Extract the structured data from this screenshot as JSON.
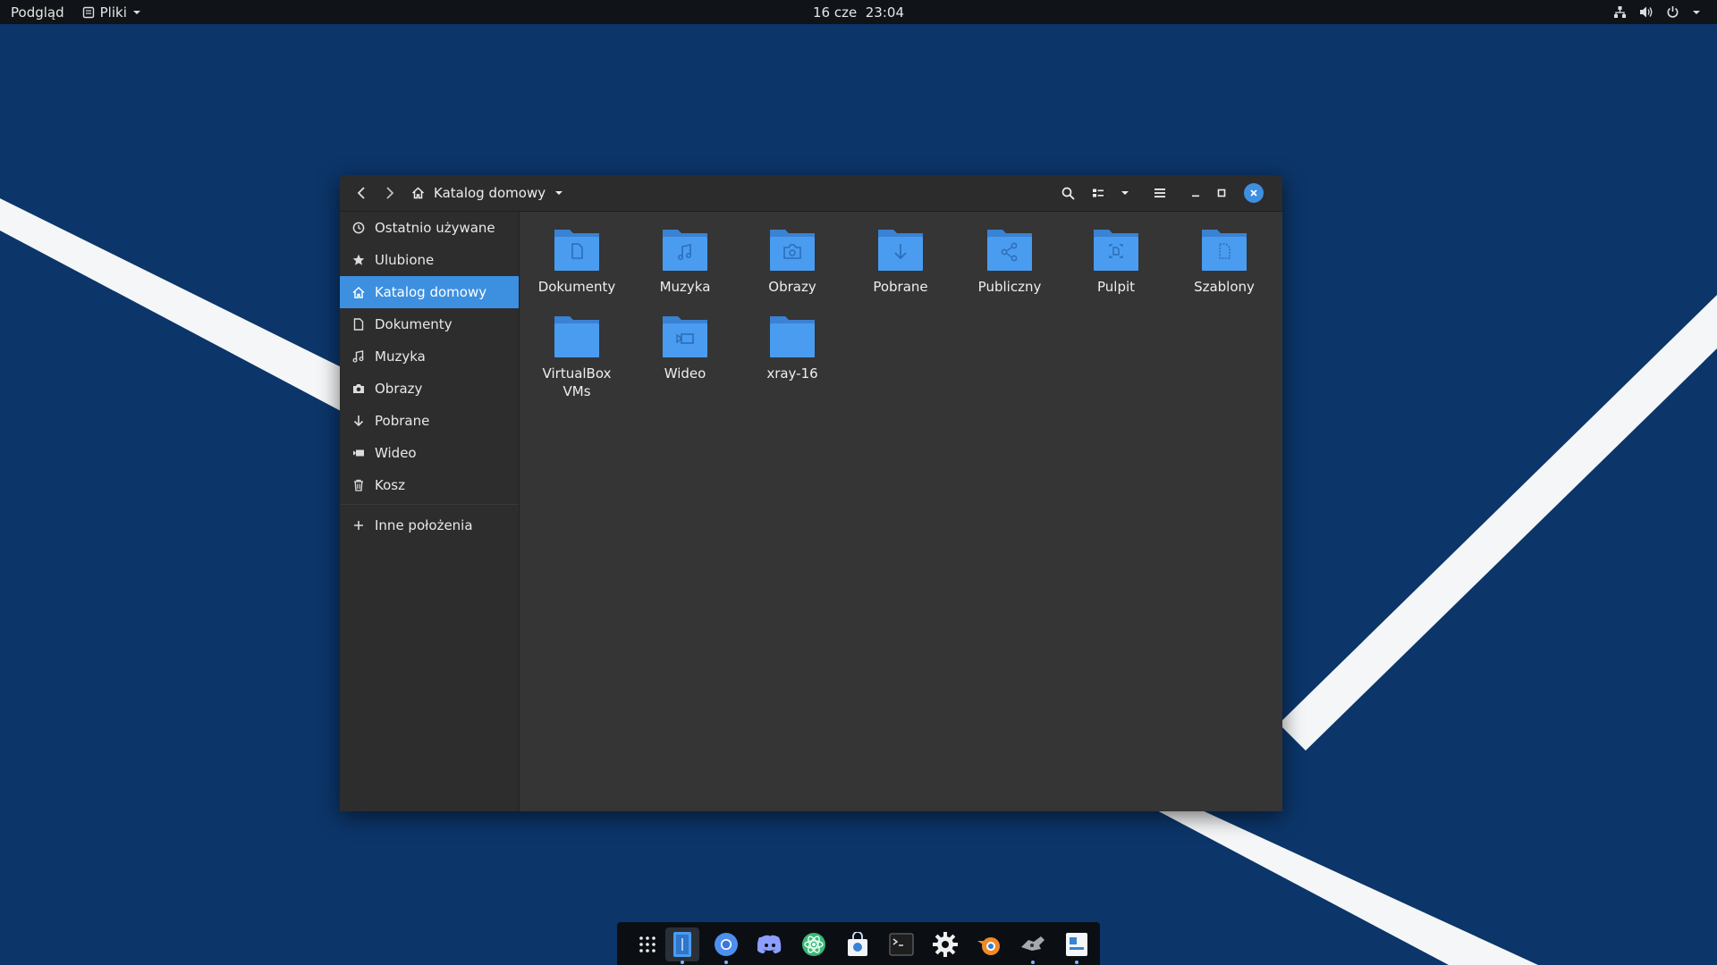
{
  "topbar": {
    "activities_label": "Podgląd",
    "app_menu_label": "Pliki",
    "date": "16 cze",
    "time": "23:04",
    "icons": [
      "network-icon",
      "volume-icon",
      "power-icon",
      "chevron-down-icon"
    ]
  },
  "window": {
    "breadcrumb_label": "Katalog domowy",
    "header_icons": [
      "back-icon",
      "forward-icon",
      "home-icon",
      "chevron-down-icon",
      "search-icon",
      "view-list-icon",
      "chevron-down-icon",
      "menu-icon",
      "minimize-icon",
      "maximize-icon",
      "close-icon"
    ]
  },
  "sidebar": {
    "items": [
      {
        "label": "Ostatnio używane",
        "icon": "clock-icon"
      },
      {
        "label": "Ulubione",
        "icon": "star-icon"
      },
      {
        "label": "Katalog domowy",
        "icon": "home-icon",
        "active": true
      },
      {
        "label": "Dokumenty",
        "icon": "document-icon"
      },
      {
        "label": "Muzyka",
        "icon": "music-icon"
      },
      {
        "label": "Obrazy",
        "icon": "camera-icon"
      },
      {
        "label": "Pobrane",
        "icon": "download-icon"
      },
      {
        "label": "Wideo",
        "icon": "video-icon"
      },
      {
        "label": "Kosz",
        "icon": "trash-icon"
      }
    ],
    "other_locations": {
      "label": "Inne położenia",
      "icon": "plus-icon"
    }
  },
  "files": [
    {
      "label": "Dokumenty",
      "emblem": "document"
    },
    {
      "label": "Muzyka",
      "emblem": "music"
    },
    {
      "label": "Obrazy",
      "emblem": "camera"
    },
    {
      "label": "Pobrane",
      "emblem": "download"
    },
    {
      "label": "Publiczny",
      "emblem": "share"
    },
    {
      "label": "Pulpit",
      "emblem": "desktop"
    },
    {
      "label": "Szablony",
      "emblem": "template"
    },
    {
      "label": "VirtualBox VMs",
      "emblem": "none"
    },
    {
      "label": "Wideo",
      "emblem": "video"
    },
    {
      "label": "xray-16",
      "emblem": "none"
    }
  ],
  "dock": {
    "items": [
      {
        "name": "app-grid",
        "icon": "app-grid-icon"
      },
      {
        "name": "files",
        "icon": "files-icon",
        "active": true,
        "running": true
      },
      {
        "name": "chromium",
        "icon": "chromium-icon",
        "running": true
      },
      {
        "name": "discord",
        "icon": "discord-icon"
      },
      {
        "name": "atom",
        "icon": "atom-icon"
      },
      {
        "name": "store",
        "icon": "store-icon"
      },
      {
        "name": "terminal",
        "icon": "terminal-icon"
      },
      {
        "name": "settings",
        "icon": "gear-icon"
      },
      {
        "name": "blender",
        "icon": "blender-icon"
      },
      {
        "name": "game",
        "icon": "game-icon",
        "running": true
      },
      {
        "name": "app",
        "icon": "app-icon",
        "running": true
      }
    ]
  },
  "colors": {
    "accent": "#3d8fe0",
    "folder": "#4a9cf0",
    "folder_dark": "#3a82d4",
    "wallpaper": "#0f3a70"
  }
}
